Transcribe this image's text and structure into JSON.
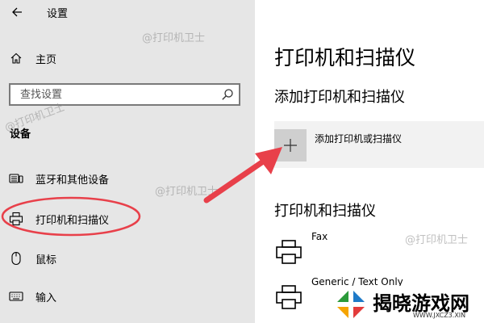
{
  "sidebar": {
    "title": "设置",
    "home_label": "主页",
    "search_placeholder": "查找设置",
    "section_label": "设备",
    "items": [
      {
        "label": "蓝牙和其他设备"
      },
      {
        "label": "打印机和扫描仪"
      },
      {
        "label": "鼠标"
      },
      {
        "label": "输入"
      }
    ]
  },
  "main": {
    "page_title": "打印机和扫描仪",
    "add_section_title": "添加打印机和扫描仪",
    "add_button_label": "添加打印机或扫描仪",
    "list_title": "打印机和扫描仪",
    "printers": [
      {
        "name": "Fax"
      },
      {
        "name": "Generic / Text Only"
      }
    ]
  },
  "watermark": "@打印机卫士",
  "brand": {
    "name": "揭晓游戏网",
    "url": "WWW.JXCZ3.XIN"
  },
  "colors": {
    "sidebar_bg": "#e6e6e6",
    "annotation_red": "#e8404a"
  }
}
